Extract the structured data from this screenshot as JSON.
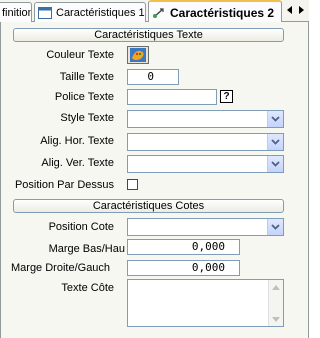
{
  "tabs": [
    {
      "label": "finition"
    },
    {
      "label": "Caractéristiques 1"
    },
    {
      "label": "Caractéristiques 2"
    }
  ],
  "sections": {
    "texte": {
      "header": "Caractéristiques Texte",
      "couleur_label": "Couleur Texte",
      "taille_label": "Taille Texte",
      "taille_value": "0",
      "police_label": "Police Texte",
      "police_value": "",
      "help_label": "?",
      "style_label": "Style Texte",
      "style_value": "",
      "alig_hor_label": "Alig. Hor. Texte",
      "alig_hor_value": "",
      "alig_ver_label": "Alig. Ver. Texte",
      "alig_ver_value": "",
      "position_dessus_label": "Position Par Dessus"
    },
    "cotes": {
      "header": "Caractéristiques Cotes",
      "position_label": "Position Cote",
      "position_value": "",
      "marge_bas_label": "Marge Bas/Hau",
      "marge_bas_value": "0,000",
      "marge_droite_label": "Marge Droite/Gauch",
      "marge_droite_value": "0,000",
      "texte_cote_label": "Texte Côte",
      "texte_cote_value": ""
    }
  },
  "colors": {
    "accent_tab": "#f1c04b",
    "border": "#7f9db9",
    "panel_bg": "#f7f7f1"
  }
}
